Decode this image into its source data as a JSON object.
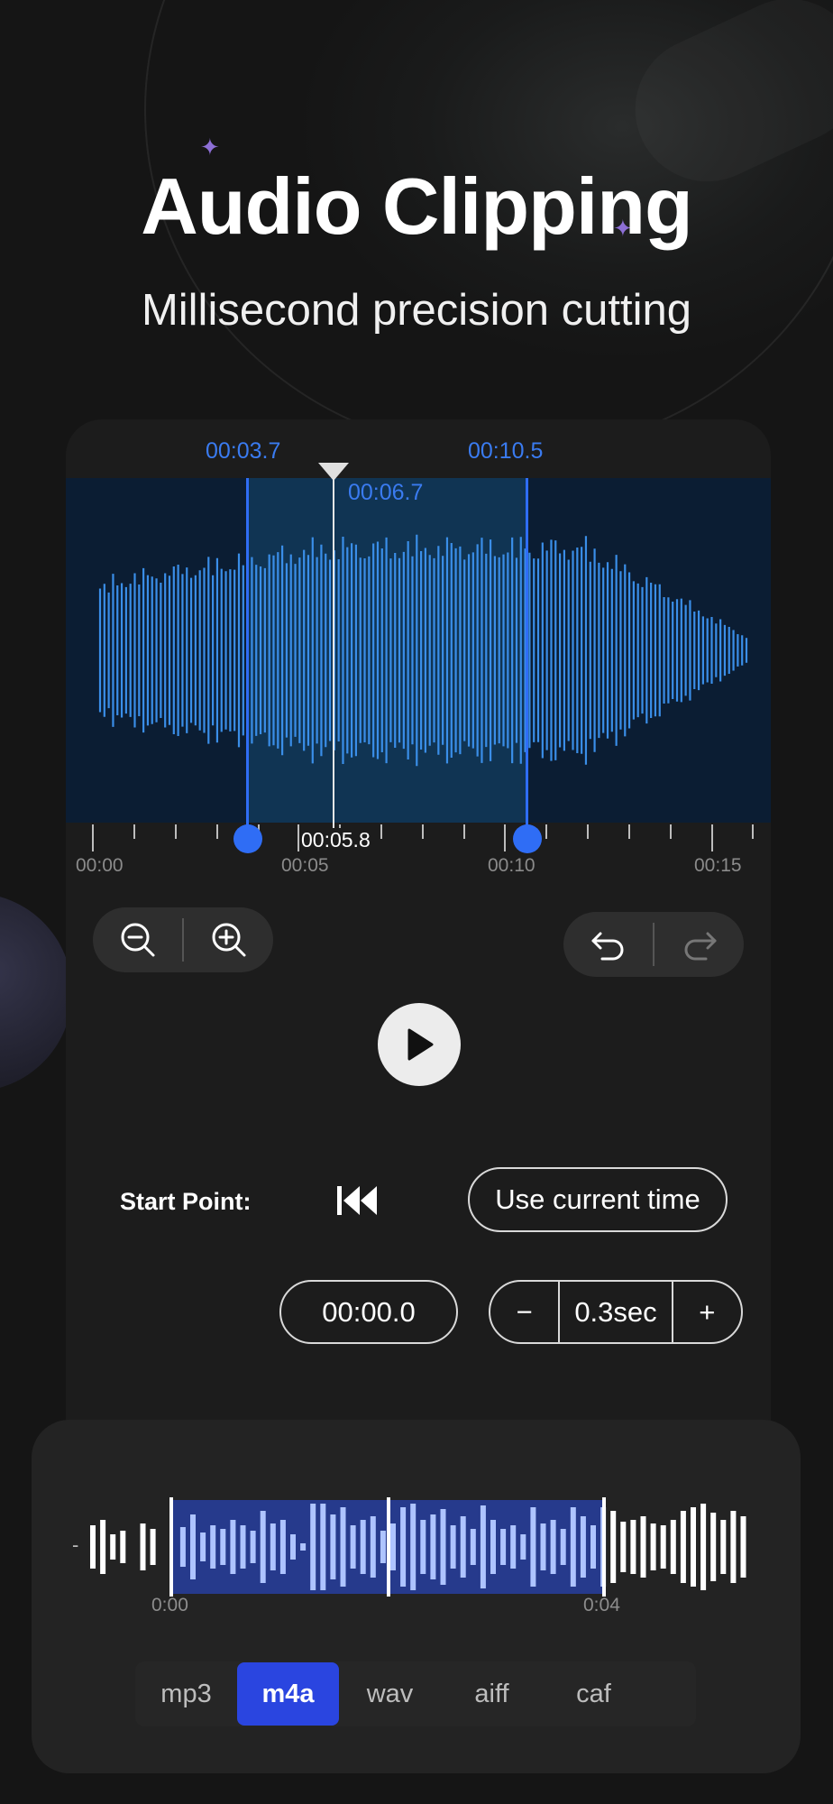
{
  "header": {
    "title": "Audio Clipping",
    "subtitle": "Millisecond precision cutting"
  },
  "editor": {
    "selection_start_label": "00:03.7",
    "selection_end_label": "00:10.5",
    "playhead_label": "00:06.7",
    "current_time": "00:05.8",
    "ruler_labels": [
      "00:00",
      "00:05",
      "00:10",
      "00:15"
    ],
    "colors": {
      "accent": "#2f6df5",
      "wave": "#3a8ee8",
      "wave_background": "#0b1d33",
      "selection_background": "#103453"
    }
  },
  "toolbar": {
    "zoom_out_icon": "zoom-out-icon",
    "zoom_in_icon": "zoom-in-icon",
    "undo_icon": "undo-icon",
    "redo_icon": "redo-icon",
    "play_icon": "play-icon"
  },
  "start_point": {
    "label": "Start Point:",
    "use_current_label": "Use current time",
    "time_value": "00:00.0",
    "step_minus": "−",
    "step_value": "0.3sec",
    "step_plus": "+"
  },
  "mini": {
    "dash": "-",
    "start_label": "0:00",
    "end_label": "0:04",
    "colors": {
      "selection": "#263a8c",
      "bars_selected": "#aec4ff",
      "bars": "#ffffff"
    }
  },
  "formats": {
    "items": [
      "mp3",
      "m4a",
      "wav",
      "aiff",
      "caf"
    ],
    "selected": "m4a",
    "colors": {
      "selected": "#2a45e0"
    }
  }
}
